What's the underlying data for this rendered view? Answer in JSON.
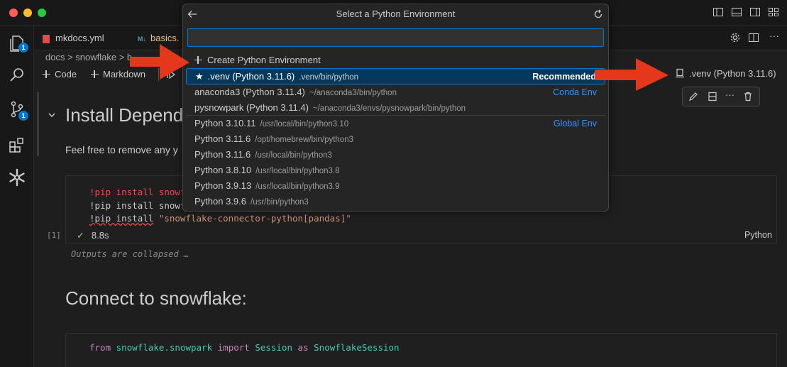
{
  "quick_pick": {
    "title": "Select a Python Environment",
    "input_value": "",
    "create_item": "Create Python Environment",
    "items": [
      {
        "label": ".venv (Python 3.11.6)",
        "path": ".venv/bin/python",
        "tag": "Recommended",
        "starred": true,
        "selected": true
      },
      {
        "label": "anaconda3 (Python 3.11.4)",
        "path": "~/anaconda3/bin/python",
        "tag": "Conda Env"
      },
      {
        "label": "pysnowpark (Python 3.11.4)",
        "path": "~/anaconda3/envs/pysnowpark/bin/python",
        "tag": ""
      },
      {
        "label": "Python 3.10.11",
        "path": "/usr/local/bin/python3.10",
        "tag": "Global Env"
      },
      {
        "label": "Python 3.11.6",
        "path": "/opt/homebrew/bin/python3",
        "tag": ""
      },
      {
        "label": "Python 3.11.6",
        "path": "/usr/local/bin/python3",
        "tag": ""
      },
      {
        "label": "Python 3.8.10",
        "path": "/usr/local/bin/python3.8",
        "tag": ""
      },
      {
        "label": "Python 3.9.13",
        "path": "/usr/local/bin/python3.9",
        "tag": ""
      },
      {
        "label": "Python 3.9.6",
        "path": "/usr/bin/python3",
        "tag": ""
      }
    ]
  },
  "tabs": [
    {
      "label": "mkdocs.yml",
      "icon": "yaml-file-icon"
    },
    {
      "label": "basics.",
      "icon": "markdown-file-icon"
    }
  ],
  "breadcrumb": "docs > snowflake > b",
  "notebook_toolbar": {
    "code": "Code",
    "markdown": "Markdown"
  },
  "kernel": {
    "label": ".venv (Python 3.11.6)"
  },
  "badges": {
    "explorer": "1",
    "scm": "1"
  },
  "cells": {
    "heading1": "Install Depende",
    "paragraph1": "Feel free to remove any y",
    "code1": {
      "line1_cmd": "!pip install snowf",
      "line2_cmd": "!pip install snowf",
      "line3_cmd": "!pip install",
      "line3_str": "\"snowflake-connector-python[pandas]\"",
      "exec_count": "[1]",
      "duration": "8.8s",
      "language": "Python"
    },
    "outputs_collapsed": "Outputs are collapsed …",
    "heading2": "Connect to snowflake:",
    "code2": {
      "kw_from": "from",
      "module": "snowflake.snowpark",
      "kw_import": "import",
      "cls": "Session",
      "kw_as": "as",
      "alias": "SnowflakeSession"
    }
  },
  "colors": {
    "accent": "#0078d4",
    "arrow": "#e5371c",
    "link": "#3794ff"
  }
}
